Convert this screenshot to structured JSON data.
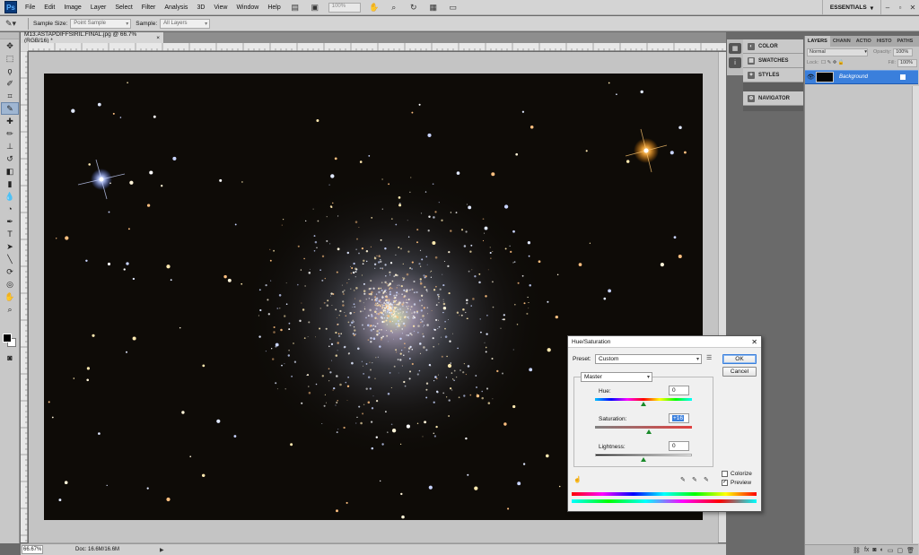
{
  "menubar": {
    "logo": "Ps",
    "items": [
      "File",
      "Edit",
      "Image",
      "Layer",
      "Select",
      "Filter",
      "Analysis",
      "3D",
      "View",
      "Window",
      "Help"
    ],
    "zoom": "100%",
    "workspace": "ESSENTIALS"
  },
  "options": {
    "sample_size_label": "Sample Size:",
    "sample_size_value": "Point Sample",
    "sample_label": "Sample:",
    "sample_value": "All Layers"
  },
  "document": {
    "tab_title": "M13.ASTAPDIFFSIRIL.FINAL.jpg @ 66.7% (RGB/16) *",
    "tab_close": "×",
    "status_zoom": "66.67%",
    "status_doc": "Doc: 16.6M/16.6M"
  },
  "dock": {
    "collapsed_panels": [
      "COLOR",
      "SWATCHES",
      "STYLES"
    ],
    "navigator": "NAVIGATOR"
  },
  "layers_panel": {
    "tabs": [
      "LAYERS",
      "CHANN",
      "ACTIO",
      "HISTO",
      "PATHS"
    ],
    "blend_mode": "Normal",
    "opacity_label": "Opacity:",
    "opacity_value": "100%",
    "lock_label": "Lock:",
    "fill_label": "Fill:",
    "fill_value": "100%",
    "layer_name": "Background"
  },
  "dialog": {
    "title": "Hue/Saturation",
    "preset_label": "Preset:",
    "preset_value": "Custom",
    "ok_label": "OK",
    "cancel_label": "Cancel",
    "channel": "Master",
    "hue_label": "Hue:",
    "hue_value": "0",
    "saturation_label": "Saturation:",
    "saturation_value": "+16",
    "lightness_label": "Lightness:",
    "lightness_value": "0",
    "colorize_label": "Colorize",
    "preview_label": "Preview",
    "colorize_checked": false,
    "preview_checked": true
  }
}
